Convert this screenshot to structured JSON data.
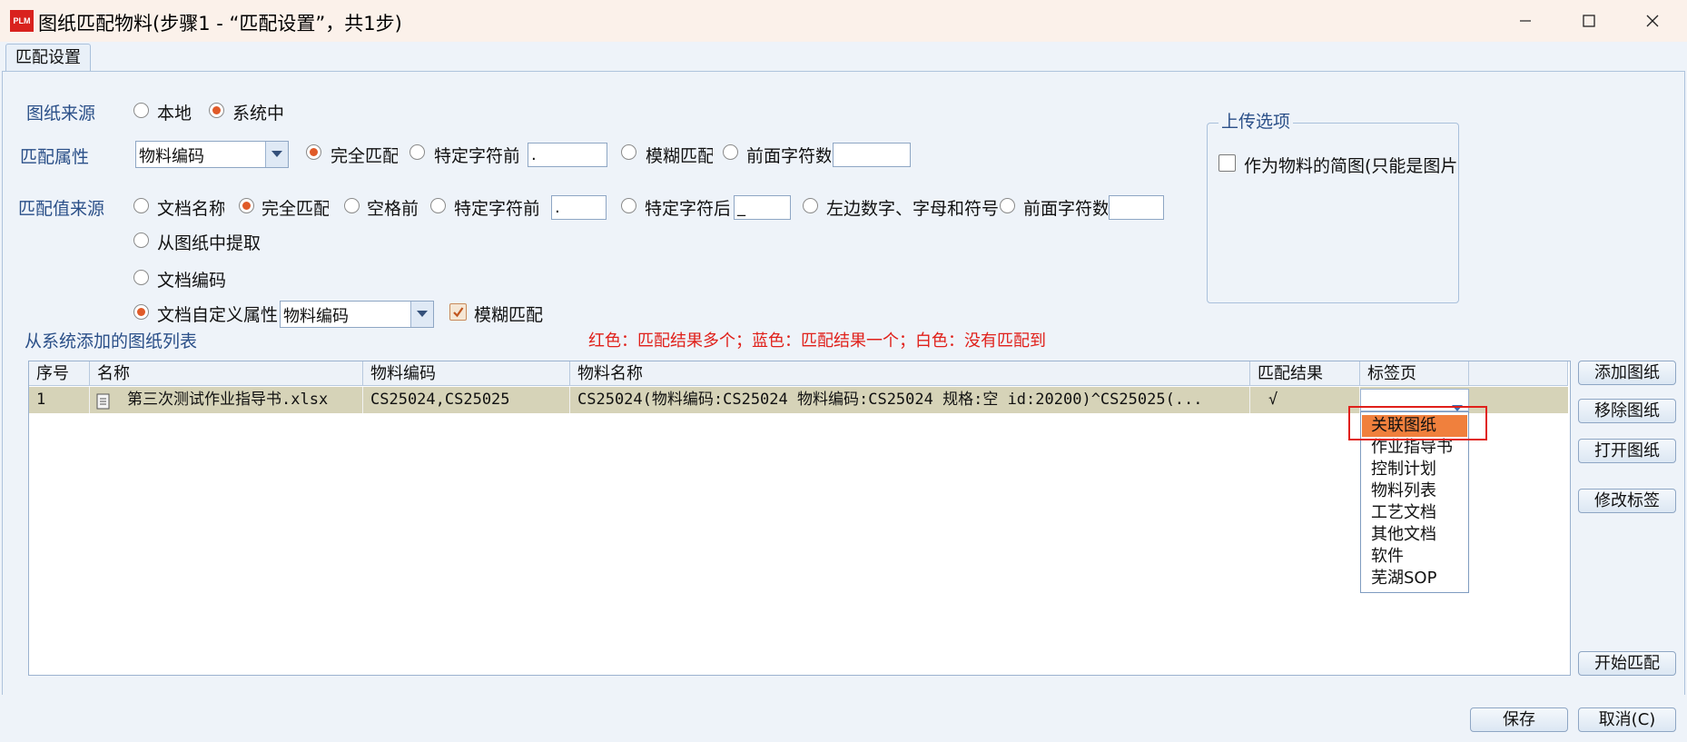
{
  "window": {
    "title": "图纸匹配物料(步骤1 - “匹配设置”，共1步)",
    "logo_text": "PLM"
  },
  "tab": {
    "label": "匹配设置"
  },
  "source": {
    "label": "图纸来源",
    "options": [
      "本地",
      "系统中"
    ],
    "selected": "系统中"
  },
  "match_attr": {
    "label": "匹配属性",
    "combo_value": "物料编码",
    "options": [
      "完全匹配",
      "特定字符前",
      "模糊匹配",
      "前面字符数"
    ],
    "selected": "完全匹配",
    "sep_value": "."
  },
  "match_value": {
    "label": "匹配值来源",
    "options": [
      "文档名称",
      "完全匹配",
      "空格前",
      "特定字符前",
      "特定字符后",
      "左边数字、字母和符号",
      "前面字符数"
    ],
    "selected_row1": "完全匹配",
    "sep_before": ".",
    "sep_after": "_",
    "extract": "从图纸中提取",
    "doc_code": "文档编码",
    "doc_custom": "文档自定义属性",
    "custom_combo": "物料编码",
    "fuzzy_label": "模糊匹配",
    "fuzzy_checked": true,
    "selected_main": "文档自定义属性"
  },
  "upload": {
    "title": "上传选项",
    "checkbox_label": "作为物料的简图(只能是图片",
    "checked": false
  },
  "list": {
    "title": "从系统添加的图纸列表",
    "legend": "红色：匹配结果多个；蓝色：匹配结果一个；白色：没有匹配到",
    "legend_color": "#e0201a",
    "columns": [
      "序号",
      "名称",
      "物料编码",
      "物料名称",
      "匹配结果",
      "标签页"
    ],
    "rows": [
      {
        "seq": "1",
        "name": "第三次测试作业指导书.xlsx",
        "code": "CS25024,CS25025",
        "material": "CS25024(物料编码:CS25024 物料编码:CS25024 规格:空 id:20200)^CS25025(...",
        "result": "√",
        "tab_page": ""
      }
    ]
  },
  "dropdown": {
    "items": [
      "关联图纸",
      "作业指导书",
      "控制计划",
      "物料列表",
      "工艺文档",
      "其他文档",
      "软件",
      "芜湖SOP"
    ],
    "highlighted": "关联图纸",
    "highlight_color": "#f0803d"
  },
  "side_buttons": {
    "add": "添加图纸",
    "remove": "移除图纸",
    "open": "打开图纸",
    "edit_tag": "修改标签",
    "start": "开始匹配"
  },
  "footer": {
    "save": "保存",
    "cancel": "取消(C)"
  }
}
